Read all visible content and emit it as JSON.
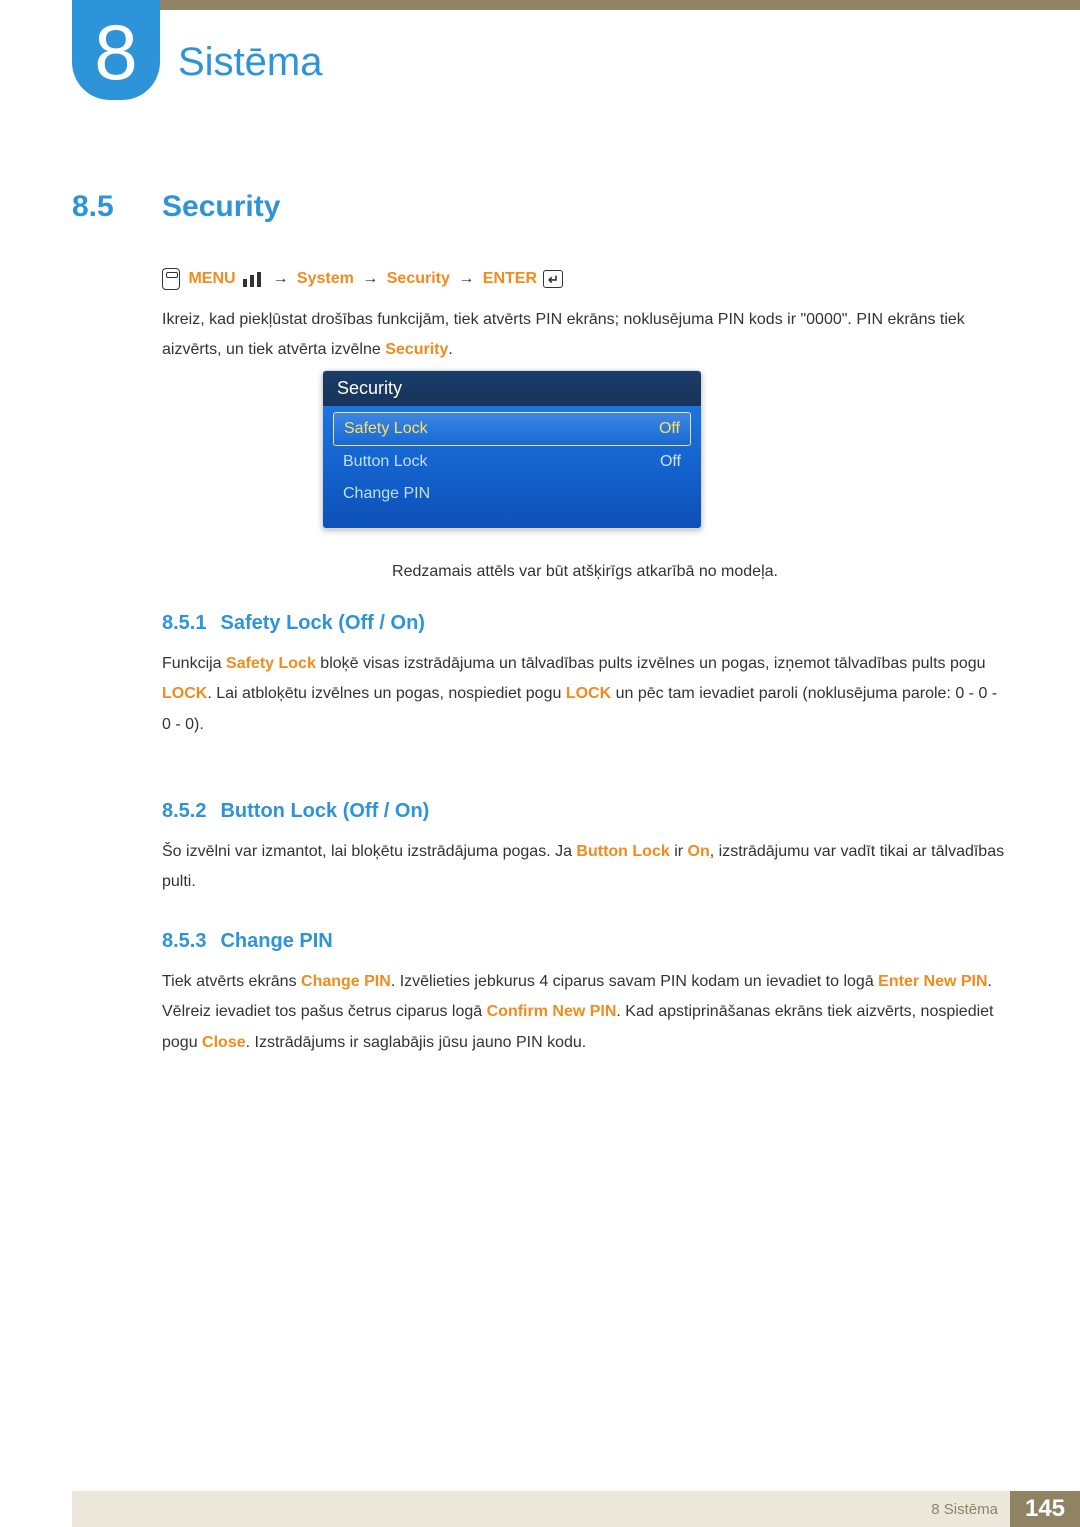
{
  "chapter": {
    "number": "8",
    "title": "Sistēma"
  },
  "section": {
    "number": "8.5",
    "title": "Security"
  },
  "nav_path": {
    "menu": "MENU",
    "system": "System",
    "security": "Security",
    "enter": "ENTER",
    "arrow": "→"
  },
  "intro": {
    "text_before": "Ikreiz, kad piekļūstat drošības funkcijām, tiek atvērts PIN ekrāns; noklusējuma PIN kods ir \"0000\". PIN ekrāns tiek aizvērts, un tiek atvērta izvēlne ",
    "highlight": "Security",
    "text_after": "."
  },
  "osd": {
    "title": "Security",
    "rows": [
      {
        "label": "Safety Lock",
        "value": "Off",
        "selected": true
      },
      {
        "label": "Button Lock",
        "value": "Off",
        "selected": false
      },
      {
        "label": "Change PIN",
        "value": "",
        "selected": false
      }
    ]
  },
  "disclaimer": "Redzamais attēls var būt atšķirīgs atkarībā no modeļa.",
  "subsections": [
    {
      "num": "8.5.1",
      "title": "Safety Lock (Off / On)",
      "parts": [
        {
          "t": "Funkcija ",
          "c": "black"
        },
        {
          "t": "Safety Lock",
          "c": "orange"
        },
        {
          "t": " bloķē visas izstrādājuma un tālvadības pults izvēlnes un pogas, izņemot tālvadības pults pogu ",
          "c": "black"
        },
        {
          "t": "LOCK",
          "c": "orange"
        },
        {
          "t": ". Lai atbloķētu izvēlnes un pogas, nospiediet pogu ",
          "c": "black"
        },
        {
          "t": "LOCK",
          "c": "orange"
        },
        {
          "t": " un pēc tam ievadiet paroli (noklusējuma parole: 0 - 0 - 0 - 0).",
          "c": "black"
        }
      ]
    },
    {
      "num": "8.5.2",
      "title": "Button Lock (Off / On)",
      "parts": [
        {
          "t": "Šo izvēlni var izmantot, lai bloķētu izstrādājuma pogas. Ja ",
          "c": "black"
        },
        {
          "t": "Button Lock",
          "c": "orange"
        },
        {
          "t": " ir ",
          "c": "black"
        },
        {
          "t": "On",
          "c": "orange"
        },
        {
          "t": ", izstrādājumu var vadīt tikai ar tālvadības pulti.",
          "c": "black"
        }
      ]
    },
    {
      "num": "8.5.3",
      "title": "Change PIN",
      "parts": [
        {
          "t": "Tiek atvērts ekrāns ",
          "c": "black"
        },
        {
          "t": "Change PIN",
          "c": "orange"
        },
        {
          "t": ". Izvēlieties jebkurus 4 ciparus savam PIN kodam un ievadiet to logā ",
          "c": "black"
        },
        {
          "t": "Enter New PIN",
          "c": "orange"
        },
        {
          "t": ". Vēlreiz ievadiet tos pašus četrus ciparus logā ",
          "c": "black"
        },
        {
          "t": "Confirm New PIN",
          "c": "orange"
        },
        {
          "t": ". Kad apstiprināšanas ekrāns tiek aizvērts, nospiediet pogu ",
          "c": "black"
        },
        {
          "t": "Close",
          "c": "orange"
        },
        {
          "t": ". Izstrādājums ir saglabājis jūsu jauno PIN kodu.",
          "c": "black"
        }
      ]
    }
  ],
  "footer": {
    "text": "8 Sistēma",
    "page": "145"
  }
}
